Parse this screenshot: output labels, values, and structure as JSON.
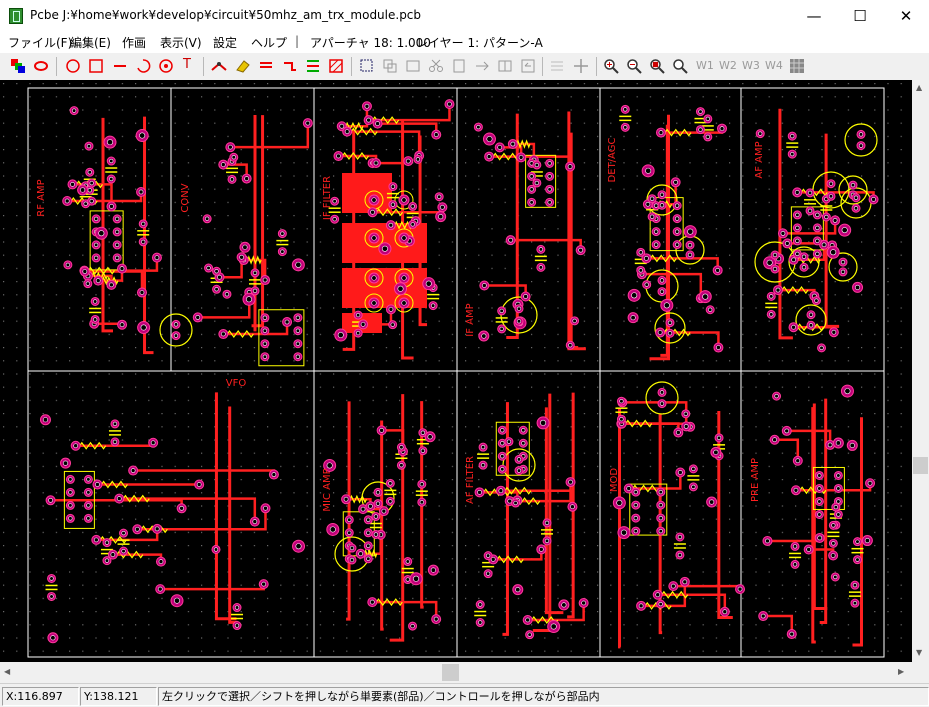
{
  "window": {
    "title": "Pcbe J:¥home¥work¥develop¥circuit¥50mhz_am_trx_module.pcb",
    "controls": {
      "minimize": "—",
      "maximize": "☐",
      "close": "✕"
    }
  },
  "menubar": {
    "items": [
      "ファイル(F)",
      "編集(E)",
      "作画",
      "表示(V)",
      "設定",
      "ヘルプ"
    ],
    "aperture": "アパーチャ 18: 1.000",
    "layer": "レイヤー 1: パターン-A"
  },
  "toolbar": {
    "window_labels": [
      "W1",
      "W2",
      "W3",
      "W4"
    ]
  },
  "pcb": {
    "module_labels": [
      "RF AMP",
      "CONV",
      "IF FILTER",
      "IF AMP",
      "DET/AGC",
      "AF AMP",
      "VFO",
      "MIC AMP",
      "AF FILTER",
      "MOD",
      "PRE AMP"
    ],
    "colors": {
      "background": "#000000",
      "trace": "#ff2020",
      "pad": "#c0007a",
      "silk": "#ffff00",
      "outline": "#ffffff"
    }
  },
  "statusbar": {
    "x": "X:116.897",
    "y": "Y:138.121",
    "message": "左クリックで選択／シフトを押しながら単要素(部品)／コントロールを押しながら部品内"
  }
}
